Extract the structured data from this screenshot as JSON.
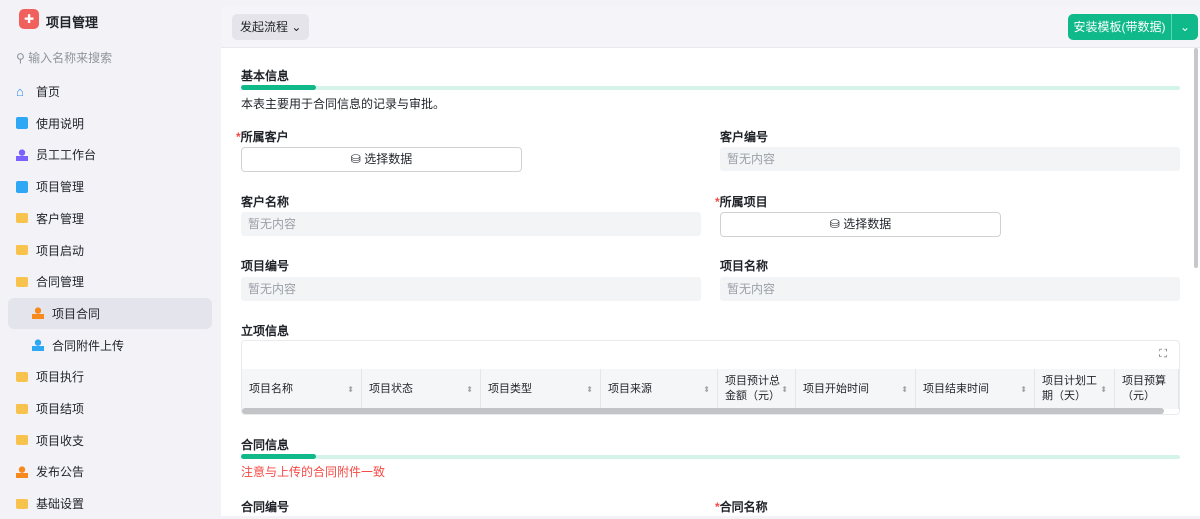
{
  "app": {
    "title": "项目管理",
    "search_placeholder": "输入名称来搜索"
  },
  "sidebar": {
    "items": [
      {
        "label": "首页",
        "icon": "home-icon"
      },
      {
        "label": "使用说明",
        "icon": "doc-icon"
      },
      {
        "label": "员工工作台",
        "icon": "user-icon"
      },
      {
        "label": "项目管理",
        "icon": "doc-icon"
      },
      {
        "label": "客户管理",
        "icon": "folder-icon"
      },
      {
        "label": "项目启动",
        "icon": "folder-icon"
      },
      {
        "label": "合同管理",
        "icon": "folder-open-icon"
      },
      {
        "label": "项目合同",
        "icon": "user-icon",
        "active": true
      },
      {
        "label": "合同附件上传",
        "icon": "user-icon"
      },
      {
        "label": "项目执行",
        "icon": "folder-icon"
      },
      {
        "label": "项目结项",
        "icon": "folder-icon"
      },
      {
        "label": "项目收支",
        "icon": "folder-icon"
      },
      {
        "label": "发布公告",
        "icon": "user-icon"
      },
      {
        "label": "基础设置",
        "icon": "folder-icon"
      }
    ]
  },
  "header": {
    "flow_button": "发起流程",
    "install_button": "安装模板(带数据)"
  },
  "form": {
    "basic": {
      "title": "基本信息",
      "desc": "本表主要用于合同信息的记录与审批。"
    },
    "customer": "所属客户",
    "customer_no": "客户编号",
    "customer_name": "客户名称",
    "project": "所属项目",
    "project_no": "项目编号",
    "project_name": "项目名称",
    "select_data": "选择数据",
    "empty": "暂无内容",
    "lixiang": {
      "title": "立项信息",
      "columns": [
        "项目名称",
        "项目状态",
        "项目类型",
        "项目来源",
        "项目预计总金额（元）",
        "项目开始时间",
        "项目结束时间",
        "项目计划工期（天）",
        "项目预算（元）"
      ]
    },
    "contract": {
      "title": "合同信息",
      "warn": "注意与上传的合同附件一致",
      "contract_no": "合同编号",
      "contract_name": "合同名称"
    }
  },
  "colors": {
    "accent": "#10b98a",
    "required": "#f54a45"
  }
}
